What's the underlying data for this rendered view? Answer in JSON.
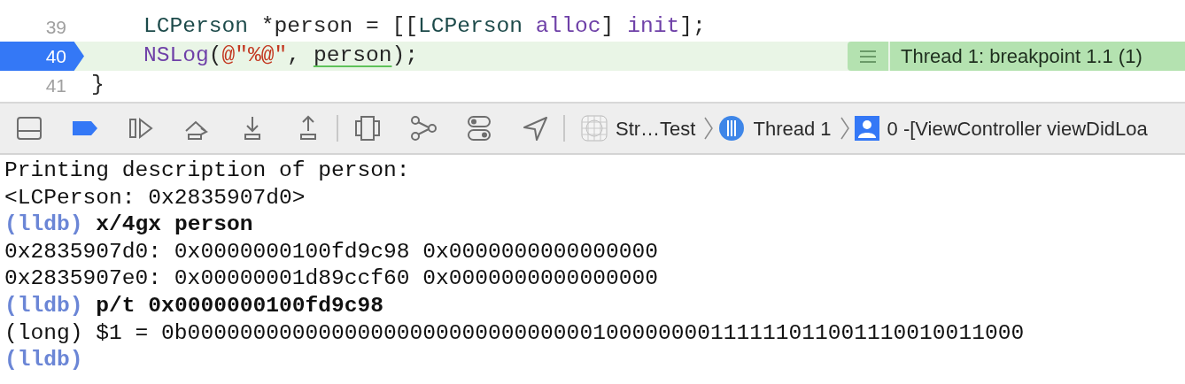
{
  "editor": {
    "lines": [
      {
        "number": "39",
        "current": false,
        "breakpoint": false,
        "indented": true,
        "tokens": [
          {
            "kind": "type",
            "text": "LCPerson"
          },
          {
            "kind": "plain",
            "text": " *person = [["
          },
          {
            "kind": "type",
            "text": "LCPerson"
          },
          {
            "kind": "method",
            "text": " alloc"
          },
          {
            "kind": "plain",
            "text": "] "
          },
          {
            "kind": "method",
            "text": "init"
          },
          {
            "kind": "plain",
            "text": "];"
          }
        ]
      },
      {
        "number": "40",
        "current": true,
        "breakpoint": true,
        "indented": true,
        "tokens": [
          {
            "kind": "method",
            "text": "NSLog"
          },
          {
            "kind": "plain",
            "text": "("
          },
          {
            "kind": "string",
            "text": "@\"%@\""
          },
          {
            "kind": "plain",
            "text": ", "
          },
          {
            "kind": "underlined",
            "text": "person"
          },
          {
            "kind": "plain",
            "text": ");"
          }
        ],
        "annotation": "Thread 1: breakpoint 1.1 (1)"
      },
      {
        "number": "41",
        "current": false,
        "breakpoint": false,
        "indented": false,
        "tokens": [
          {
            "kind": "plain",
            "text": "}"
          }
        ]
      }
    ]
  },
  "debug_bar": {
    "breakpoints_active": true,
    "breadcrumb": [
      {
        "kind": "project",
        "text": "Str…Test"
      },
      {
        "kind": "thread",
        "text": "Thread 1"
      },
      {
        "kind": "frame",
        "text": "0 -[ViewController viewDidLoa"
      }
    ]
  },
  "console": {
    "lines": [
      {
        "kind": "output",
        "text": "Printing description of person:"
      },
      {
        "kind": "output",
        "text": "<LCPerson: 0x2835907d0>"
      },
      {
        "kind": "command",
        "prompt": "(lldb)",
        "text": "x/4gx person"
      },
      {
        "kind": "output",
        "text": "0x2835907d0: 0x0000000100fd9c98 0x0000000000000000"
      },
      {
        "kind": "output",
        "text": "0x2835907e0: 0x00000001d89ccf60 0x0000000000000000"
      },
      {
        "kind": "command",
        "prompt": "(lldb)",
        "text": "p/t 0x0000000100fd9c98"
      },
      {
        "kind": "output",
        "text": "(long) $1 = 0b0000000000000000000000000000000100000000111111011001110010011000"
      },
      {
        "kind": "command",
        "prompt": "(lldb)"
      }
    ]
  }
}
